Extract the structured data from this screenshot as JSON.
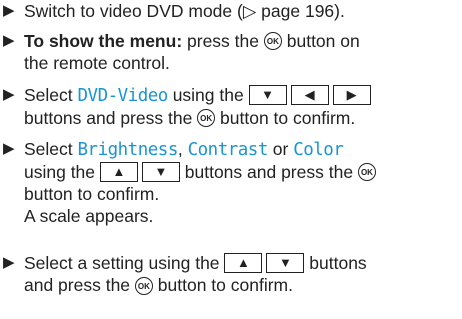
{
  "icons": {
    "bullet": "black-right-triangle",
    "ok": "OK",
    "up": "▲",
    "down": "▼",
    "left": "◀",
    "right": "▶",
    "page_ref": "▷"
  },
  "steps": [
    {
      "text_a": "Switch to video DVD mode (",
      "page_ref_icon": "▷",
      "text_b": " page 196)."
    },
    {
      "bold": "To show the menu:",
      "text_a": " press the ",
      "text_b": " button on",
      "line2": "the remote control."
    },
    {
      "text_a": "Select ",
      "hl": "DVD-Video",
      "text_b": " using the ",
      "line2": "buttons and press the ",
      "line2_b": " button to confirm."
    },
    {
      "text_a": "Select ",
      "hl1": "Brightness",
      "sep1": ", ",
      "hl2": "Contrast",
      "sep2": " or ",
      "hl3": "Color",
      "line2": "using the ",
      "line2_b": " buttons and press the ",
      "line3": "button to confirm.",
      "line4": "A scale appears."
    },
    {
      "text_a": "Select a setting using the ",
      "text_b": " buttons",
      "line2": "and press the ",
      "line2_b": " button to confirm."
    }
  ],
  "colors": {
    "highlight": "#1a95d1",
    "text": "#222222"
  }
}
